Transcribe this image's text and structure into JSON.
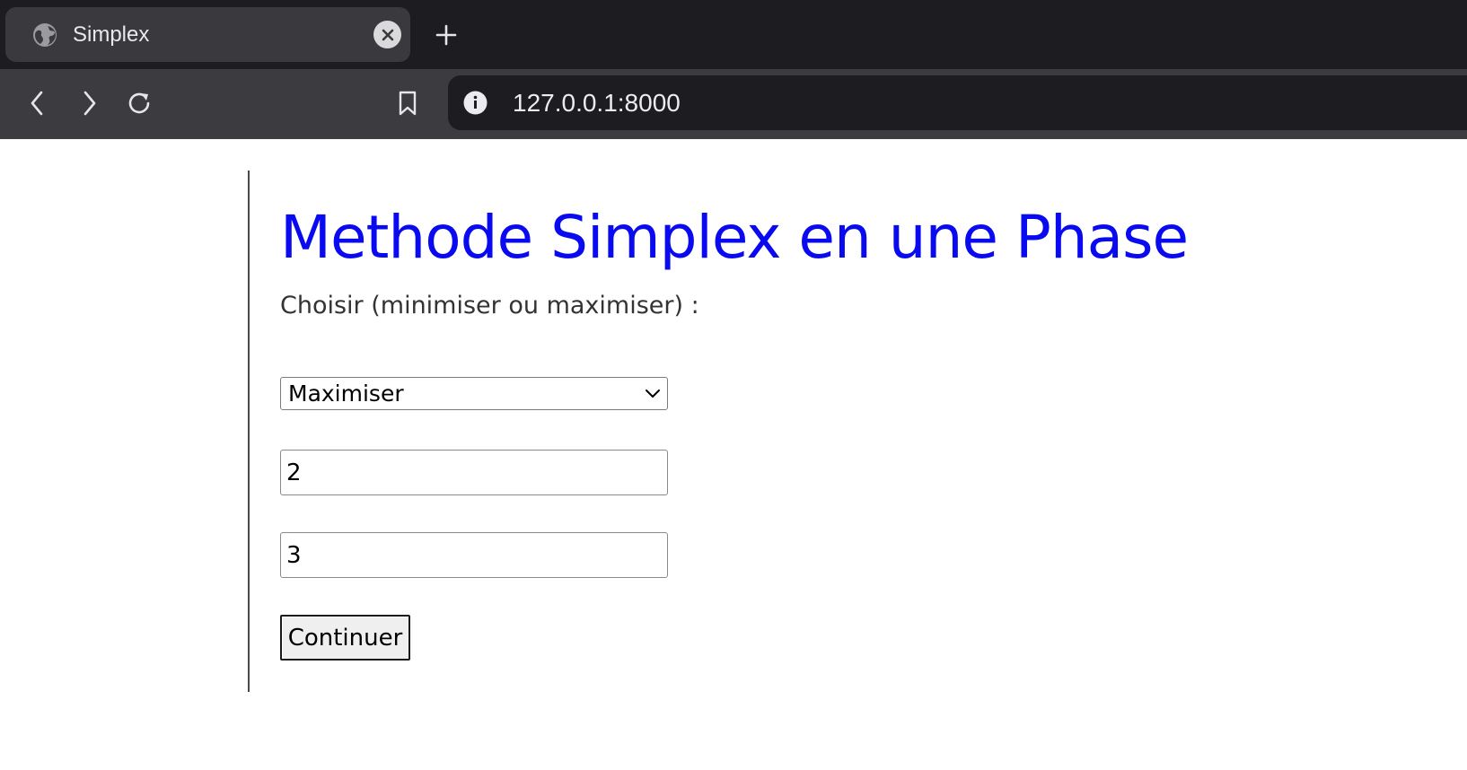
{
  "browser": {
    "tab": {
      "title": "Simplex",
      "favicon": "globe-icon",
      "close_icon": "close-icon"
    },
    "new_tab_icon": "plus-icon",
    "toolbar": {
      "back_icon": "chevron-left-icon",
      "forward_icon": "chevron-right-icon",
      "reload_icon": "reload-icon",
      "bookmark_icon": "bookmark-icon"
    },
    "address_bar": {
      "info_icon": "info-icon",
      "url": "127.0.0.1:8000"
    },
    "colors": {
      "tabbar_bg": "#1d1d21",
      "toolbar_bg": "#3c3c40",
      "active_tab_bg": "#3a3a3e"
    }
  },
  "page": {
    "heading": "Methode Simplex en une Phase",
    "heading_color": "#0a0af0",
    "prompt": "Choisir (minimiser ou maximiser) :",
    "form": {
      "objective_select": {
        "selected": "Maximiser"
      },
      "field_1_value": "2",
      "field_2_value": "3",
      "submit_label": "Continuer"
    }
  }
}
